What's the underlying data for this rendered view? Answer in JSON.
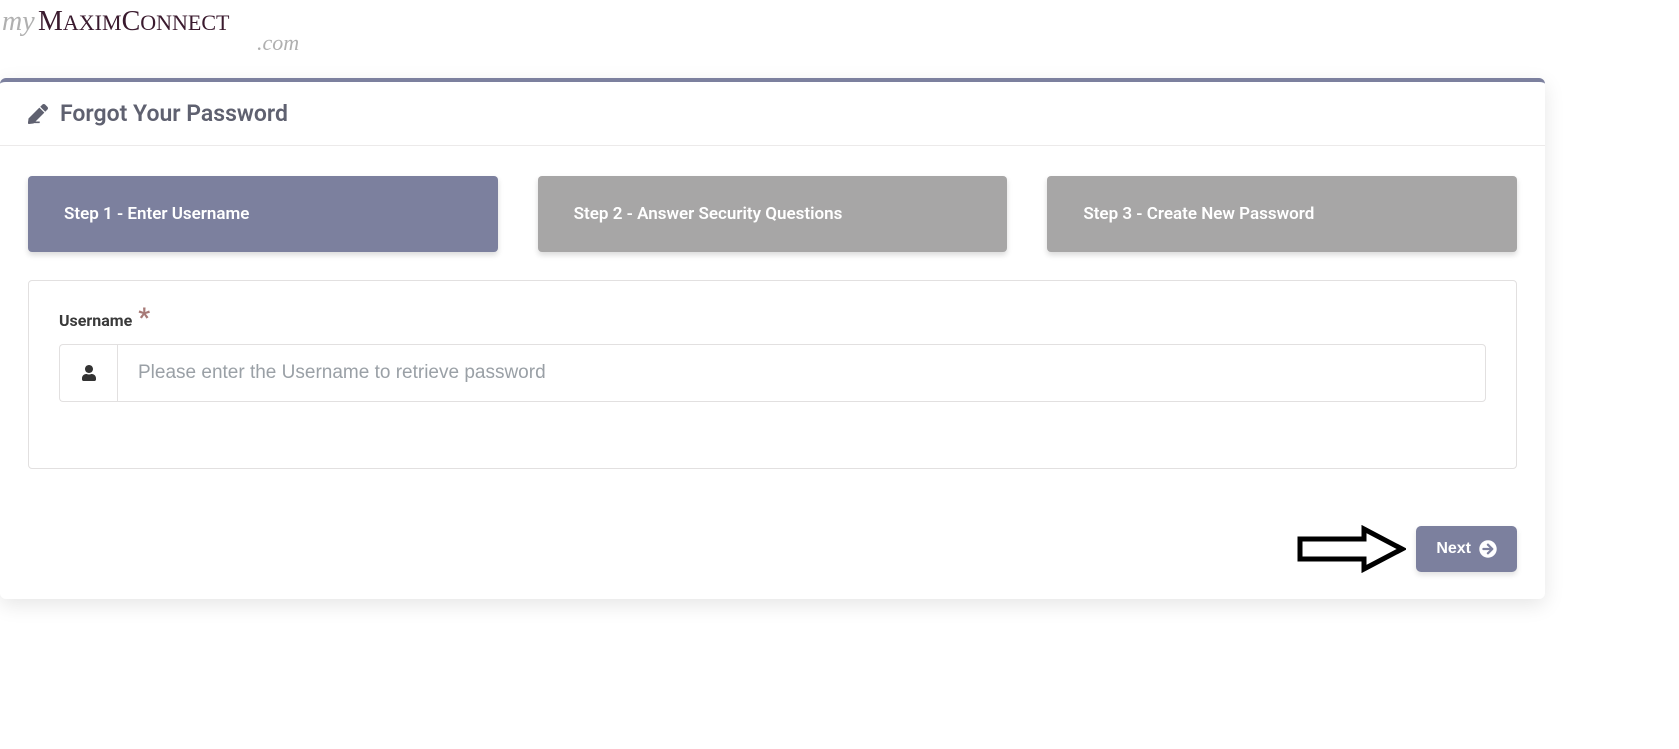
{
  "logo": {
    "name": "myMaximConnect.com",
    "parts": {
      "pre": "my",
      "main": "MAXIMCONNECT",
      "suffix": ".com"
    }
  },
  "card": {
    "title": "Forgot Your Password"
  },
  "steps": [
    {
      "label": "Step 1 - Enter Username",
      "state": "active"
    },
    {
      "label": "Step 2 - Answer Security Questions",
      "state": "inactive"
    },
    {
      "label": "Step 3 - Create New Password",
      "state": "inactive"
    }
  ],
  "form": {
    "username": {
      "label": "Username",
      "required_mark": "*",
      "placeholder": "Please enter the Username to retrieve password",
      "value": ""
    }
  },
  "actions": {
    "next_label": "Next"
  }
}
